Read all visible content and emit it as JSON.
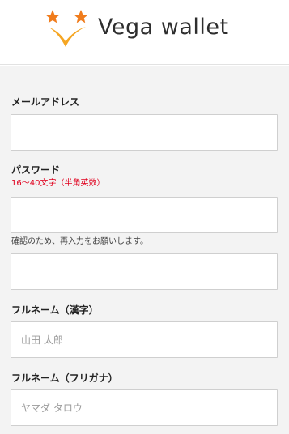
{
  "header": {
    "brand": "Vega wallet",
    "logo_icon": "stars-v-logo-icon",
    "colors": {
      "star": "#f07c1c",
      "v": "#f5a623",
      "text": "#2e2e2e"
    }
  },
  "form": {
    "email": {
      "label": "メールアドレス",
      "value": "",
      "placeholder": ""
    },
    "password": {
      "label": "パスワード",
      "hint": "16〜40文字（半角英数）",
      "value": "",
      "placeholder": ""
    },
    "password_confirm": {
      "hint": "確認のため、再入力をお願いします。",
      "value": "",
      "placeholder": ""
    },
    "fullname_kanji": {
      "label": "フルネーム（漢字）",
      "value": "",
      "placeholder": "山田 太郎"
    },
    "fullname_kana": {
      "label": "フルネーム（フリガナ）",
      "value": "",
      "placeholder": "ヤマダ タロウ"
    }
  },
  "colors": {
    "hint_red": "#e0001e",
    "background": "#f3f3f3",
    "field_border": "#cfcfcf"
  }
}
